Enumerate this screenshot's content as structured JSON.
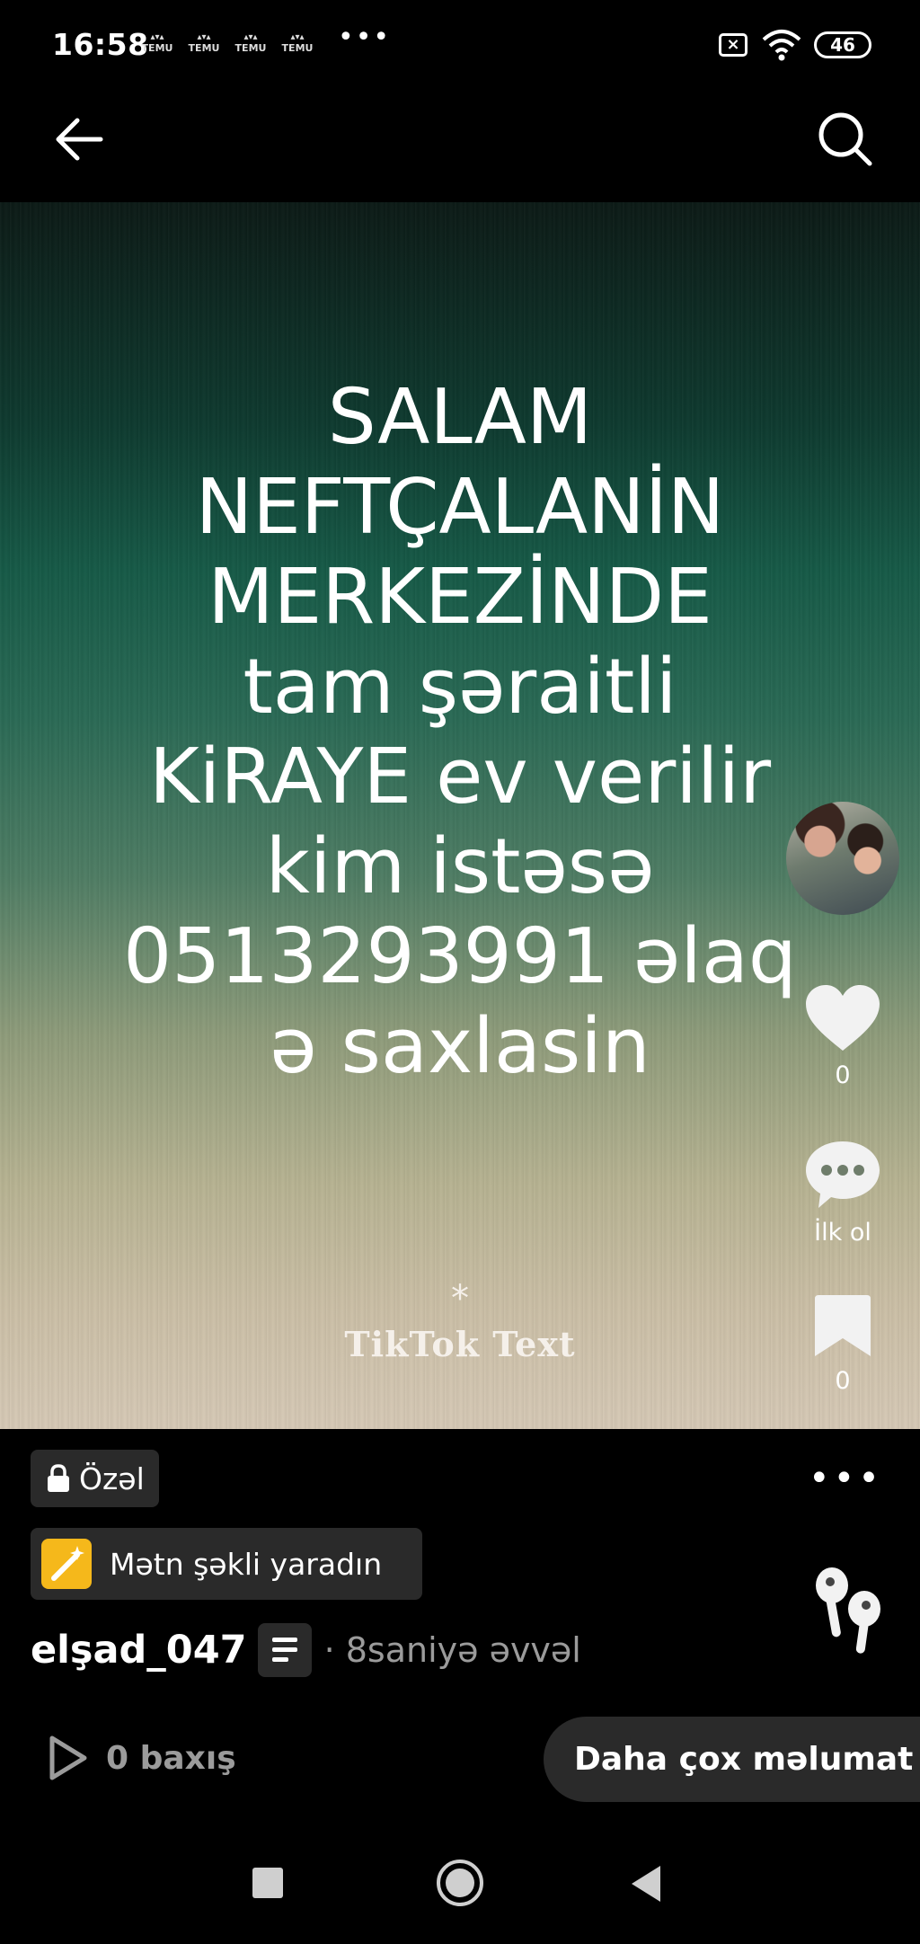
{
  "status_bar": {
    "time": "16:58",
    "notification_icons": [
      "TEMU",
      "TEMU",
      "TEMU",
      "TEMU"
    ],
    "more": "•••",
    "battery": "46"
  },
  "video": {
    "text_lines": [
      "SALAM",
      "NEFTÇALANİN",
      "MERKEZİNDE",
      "tam şəraitli",
      "KiRAYE  ev verilir",
      "kim istəsə",
      "0513293991 əlaq",
      "ə saxlasin"
    ],
    "watermark_star": "*",
    "watermark": "TikTok Text"
  },
  "actions": {
    "likes": "0",
    "comments": "İlk ol",
    "saves": "0"
  },
  "info": {
    "privacy_label": "Özəl",
    "more": "•••",
    "create_text_image": "Mətn şəkli yaradın",
    "author": "elşad_047",
    "time_ago": "· 8saniyə əvvəl",
    "views": "0 baxış",
    "more_info": "Daha çox məlumat"
  },
  "colors": {
    "background": "#000000",
    "chip_bg": "#2a2a2a",
    "accent_yellow": "#f5b81b",
    "muted_text": "#9b9b9b"
  }
}
